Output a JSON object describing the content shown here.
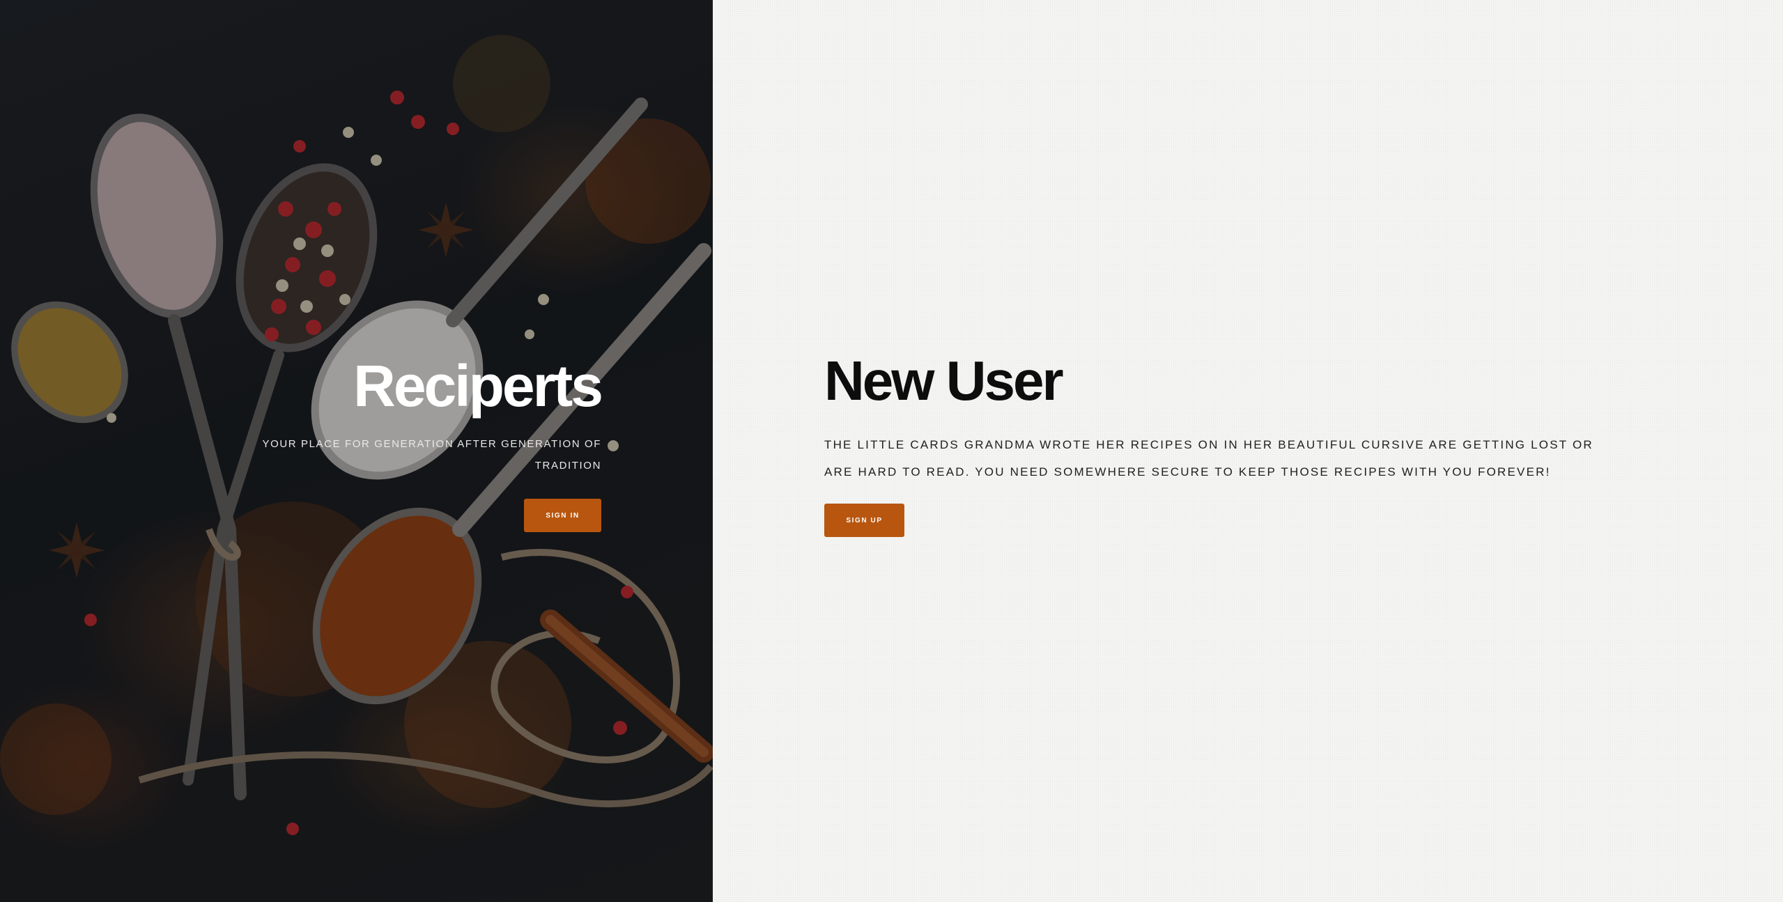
{
  "colors": {
    "accent": "#b8560f",
    "hero_text": "#ffffff",
    "panel_background": "#f4f5f3",
    "panel_text": "#0d0d0d"
  },
  "hero": {
    "background_image": "spices-and-spoons-photo",
    "title": "Reciperts",
    "tagline": "YOUR PLACE FOR GENERATION AFTER GENERATION OF TRADITION",
    "signin_label": "SIGN IN"
  },
  "new_user": {
    "title": "New User",
    "body": "THE LITTLE CARDS GRANDMA WROTE HER RECIPES ON IN HER BEAUTIFUL CURSIVE ARE GETTING LOST OR ARE HARD TO READ. YOU NEED SOMEWHERE SECURE TO KEEP THOSE RECIPES WITH YOU FOREVER!",
    "signup_label": "SIGN UP"
  }
}
